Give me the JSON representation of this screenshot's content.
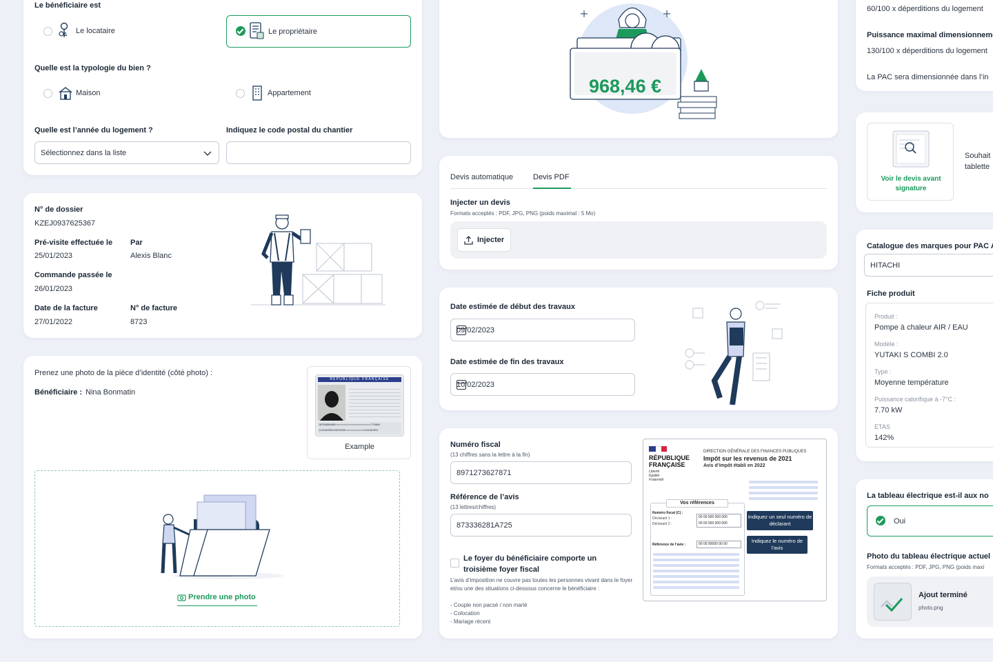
{
  "beneficiaire": {
    "question": "Le bénéficiaire est",
    "options": [
      "Le locataire",
      "Le propriétaire"
    ],
    "selected": "Le propriétaire"
  },
  "typologie": {
    "question": "Quelle est la typologie du bien ?",
    "options": [
      "Maison",
      "Appartement"
    ]
  },
  "annee": {
    "label": "Quelle est l’année du logement ?",
    "value": "Sélectionnez dans la liste"
  },
  "code_postal": {
    "label": "Indiquez le code postal du chantier",
    "value": ""
  },
  "dossier": {
    "numero_label": "N° de dossier",
    "numero": "KZEJ0937625367",
    "previsite_label": "Pré-visite effectuée le",
    "previsite": "25/01/2023",
    "par_label": "Par",
    "par": "Alexis Blanc",
    "commande_label": "Commande passée le",
    "commande": "26/01/2023",
    "facture_date_label": "Date de la facture",
    "facture_date": "27/01/2022",
    "facture_num_label": "N° de facture",
    "facture_num": "8723"
  },
  "identite": {
    "prompt": "Prenez une photo de la pièce d’identité (côté photo) :",
    "beneficiaire_label": "Bénéficiaire :",
    "beneficiaire": "Nina Bonmatin",
    "example_caption": "Example",
    "id_card_header": "RÉPUBLIQUE FRANÇAISE",
    "id_card_mrz1": "IDFRADURAND<<<<<<<<<<<<<<<<<<<<<<<<775000",
    "id_card_mrz2": "1234567890?ARTOIRE<<<<<<<<<<<<1234567891",
    "photo_button": "Prendre une photo"
  },
  "montant": {
    "value": "968,46 €"
  },
  "devis": {
    "tabs": [
      "Devis automatique",
      "Devis PDF"
    ],
    "active_tab": "Devis PDF",
    "inject_title": "Injecter un devis",
    "formats": "Formats acceptés : PDF, JPG, PNG (poids maximal : 5 Mo)",
    "inject_button": "Injecter"
  },
  "dates": {
    "debut_label": "Date estimée de début des travaux",
    "debut": "09/02/2023",
    "fin_label": "Date estimée de fin des travaux",
    "fin": "10/02/2023"
  },
  "fiscal": {
    "numero_label": "Numéro fiscal",
    "numero_hint": "(13 chiffres sans la lettre à la fin)",
    "numero": "8971273627871",
    "reference_label": "Référence de l’avis",
    "reference_hint": "(13 lettres/chiffres)",
    "reference": "873336281A725",
    "foyer_label": "Le foyer du bénéficiaire comporte un troisième foyer fiscal",
    "foyer_desc": "L’avis d’imposition ne couvre pas toutes les personnes vivant dans le foyer et/ou une des situations ci-dessous concerne le bénéficiaire :",
    "foyer_items": [
      "- Couple non pacsé / non marié",
      "- Colocation",
      "- Mariage récent"
    ]
  },
  "avis_doc": {
    "rf": "RÉPUBLIQUE FRANÇAISE",
    "devise": [
      "Liberté",
      "Égalité",
      "Fraternité"
    ],
    "dgfip": "DIRECTION GÉNÉRALE DES FINANCES PUBLIQUES",
    "title": "Impôt sur les revenus de 2021",
    "subtitle": "Avis d’impôt établi en 2022",
    "refs_title": "Vos références",
    "numero_fiscal": "Numéro fiscal (C) :",
    "declarant1": "Déclarant 1 :",
    "declarant2": "Déclarant 2 :",
    "placeholder_num": "00 00 000 000 000",
    "reference_avis": "Référence de l’avis :",
    "placeholder_ref": "00 00 00000 00 00",
    "tip1": "Indiquez un seul numéro de déclarant",
    "tip2": "Indiquez le numéro de l’avis"
  },
  "right": {
    "line1": "60/100 x déperditions du logement",
    "puissance_label": "Puissance maximal dimensionnement",
    "line2": "130/100 x déperditions du logement",
    "line3": "La PAC sera dimensionnée dans l’in",
    "voir_devis": "Voir le devis avant signature",
    "souhait": "Souhait",
    "tablette": "tablette",
    "catalogue_label": "Catalogue des marques pour PAC A",
    "catalogue_value": "HITACHI",
    "fiche_label": "Fiche produit",
    "fiche": [
      {
        "k": "Produit :",
        "v": "Pompe à chaleur AIR / EAU"
      },
      {
        "k": "Modèle :",
        "v": "YUTAKI S COMBI 2.0"
      },
      {
        "k": "Type :",
        "v": "Moyenne température"
      },
      {
        "k": "Puissance calorifique à -7°C :",
        "v": "7.70 kW"
      },
      {
        "k": "ETAS",
        "v": "142%"
      }
    ],
    "tableau_label": "La tableau électrique est-il aux no",
    "oui": "Oui",
    "photo_label": "Photo du tableau électrique actuel",
    "photo_formats": "Formats acceptés : PDF, JPG, PNG (poids maxi",
    "ajout": "Ajout terminé",
    "filename": "photo.png"
  }
}
